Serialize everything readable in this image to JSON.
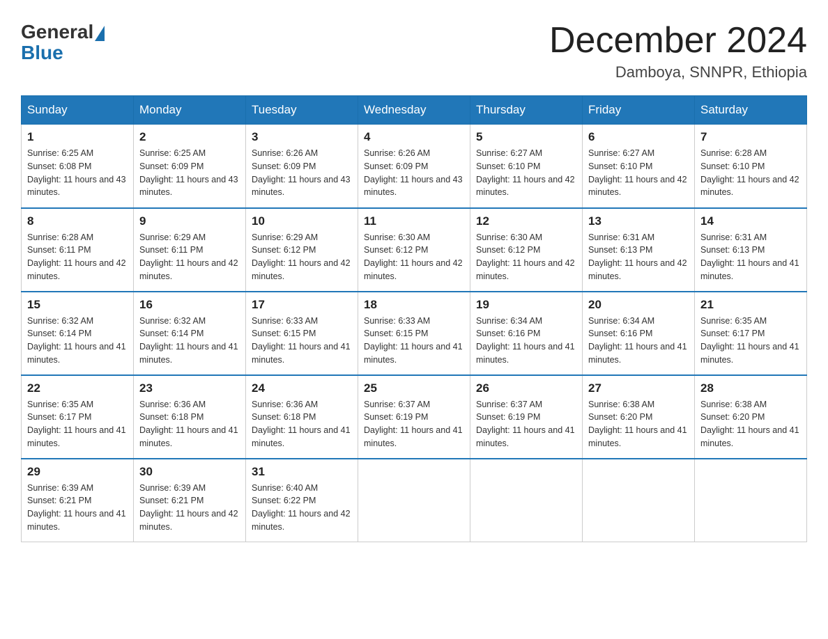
{
  "logo": {
    "general": "General",
    "blue": "Blue"
  },
  "header": {
    "month_year": "December 2024",
    "location": "Damboya, SNNPR, Ethiopia"
  },
  "weekdays": [
    "Sunday",
    "Monday",
    "Tuesday",
    "Wednesday",
    "Thursday",
    "Friday",
    "Saturday"
  ],
  "weeks": [
    [
      {
        "day": "1",
        "sunrise": "6:25 AM",
        "sunset": "6:08 PM",
        "daylight": "11 hours and 43 minutes."
      },
      {
        "day": "2",
        "sunrise": "6:25 AM",
        "sunset": "6:09 PM",
        "daylight": "11 hours and 43 minutes."
      },
      {
        "day": "3",
        "sunrise": "6:26 AM",
        "sunset": "6:09 PM",
        "daylight": "11 hours and 43 minutes."
      },
      {
        "day": "4",
        "sunrise": "6:26 AM",
        "sunset": "6:09 PM",
        "daylight": "11 hours and 43 minutes."
      },
      {
        "day": "5",
        "sunrise": "6:27 AM",
        "sunset": "6:10 PM",
        "daylight": "11 hours and 42 minutes."
      },
      {
        "day": "6",
        "sunrise": "6:27 AM",
        "sunset": "6:10 PM",
        "daylight": "11 hours and 42 minutes."
      },
      {
        "day": "7",
        "sunrise": "6:28 AM",
        "sunset": "6:10 PM",
        "daylight": "11 hours and 42 minutes."
      }
    ],
    [
      {
        "day": "8",
        "sunrise": "6:28 AM",
        "sunset": "6:11 PM",
        "daylight": "11 hours and 42 minutes."
      },
      {
        "day": "9",
        "sunrise": "6:29 AM",
        "sunset": "6:11 PM",
        "daylight": "11 hours and 42 minutes."
      },
      {
        "day": "10",
        "sunrise": "6:29 AM",
        "sunset": "6:12 PM",
        "daylight": "11 hours and 42 minutes."
      },
      {
        "day": "11",
        "sunrise": "6:30 AM",
        "sunset": "6:12 PM",
        "daylight": "11 hours and 42 minutes."
      },
      {
        "day": "12",
        "sunrise": "6:30 AM",
        "sunset": "6:12 PM",
        "daylight": "11 hours and 42 minutes."
      },
      {
        "day": "13",
        "sunrise": "6:31 AM",
        "sunset": "6:13 PM",
        "daylight": "11 hours and 42 minutes."
      },
      {
        "day": "14",
        "sunrise": "6:31 AM",
        "sunset": "6:13 PM",
        "daylight": "11 hours and 41 minutes."
      }
    ],
    [
      {
        "day": "15",
        "sunrise": "6:32 AM",
        "sunset": "6:14 PM",
        "daylight": "11 hours and 41 minutes."
      },
      {
        "day": "16",
        "sunrise": "6:32 AM",
        "sunset": "6:14 PM",
        "daylight": "11 hours and 41 minutes."
      },
      {
        "day": "17",
        "sunrise": "6:33 AM",
        "sunset": "6:15 PM",
        "daylight": "11 hours and 41 minutes."
      },
      {
        "day": "18",
        "sunrise": "6:33 AM",
        "sunset": "6:15 PM",
        "daylight": "11 hours and 41 minutes."
      },
      {
        "day": "19",
        "sunrise": "6:34 AM",
        "sunset": "6:16 PM",
        "daylight": "11 hours and 41 minutes."
      },
      {
        "day": "20",
        "sunrise": "6:34 AM",
        "sunset": "6:16 PM",
        "daylight": "11 hours and 41 minutes."
      },
      {
        "day": "21",
        "sunrise": "6:35 AM",
        "sunset": "6:17 PM",
        "daylight": "11 hours and 41 minutes."
      }
    ],
    [
      {
        "day": "22",
        "sunrise": "6:35 AM",
        "sunset": "6:17 PM",
        "daylight": "11 hours and 41 minutes."
      },
      {
        "day": "23",
        "sunrise": "6:36 AM",
        "sunset": "6:18 PM",
        "daylight": "11 hours and 41 minutes."
      },
      {
        "day": "24",
        "sunrise": "6:36 AM",
        "sunset": "6:18 PM",
        "daylight": "11 hours and 41 minutes."
      },
      {
        "day": "25",
        "sunrise": "6:37 AM",
        "sunset": "6:19 PM",
        "daylight": "11 hours and 41 minutes."
      },
      {
        "day": "26",
        "sunrise": "6:37 AM",
        "sunset": "6:19 PM",
        "daylight": "11 hours and 41 minutes."
      },
      {
        "day": "27",
        "sunrise": "6:38 AM",
        "sunset": "6:20 PM",
        "daylight": "11 hours and 41 minutes."
      },
      {
        "day": "28",
        "sunrise": "6:38 AM",
        "sunset": "6:20 PM",
        "daylight": "11 hours and 41 minutes."
      }
    ],
    [
      {
        "day": "29",
        "sunrise": "6:39 AM",
        "sunset": "6:21 PM",
        "daylight": "11 hours and 41 minutes."
      },
      {
        "day": "30",
        "sunrise": "6:39 AM",
        "sunset": "6:21 PM",
        "daylight": "11 hours and 42 minutes."
      },
      {
        "day": "31",
        "sunrise": "6:40 AM",
        "sunset": "6:22 PM",
        "daylight": "11 hours and 42 minutes."
      },
      null,
      null,
      null,
      null
    ]
  ],
  "labels": {
    "sunrise": "Sunrise:",
    "sunset": "Sunset:",
    "daylight": "Daylight:"
  }
}
